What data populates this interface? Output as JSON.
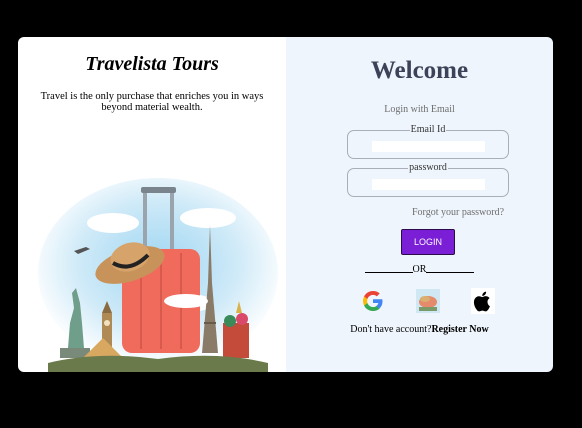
{
  "brand": {
    "title": "Travelista Tours",
    "tagline": "Travel is the only purchase that enriches you in ways beyond material wealth."
  },
  "login": {
    "heading": "Welcome",
    "subheading": "Login with Email",
    "email_label": "Email Id",
    "email_value": "",
    "password_label": "password",
    "password_value": "",
    "forgot_link": "Forgot your password?",
    "login_button": "LOGIN",
    "or_text": "OR",
    "register_prompt": "Don't have account?",
    "register_link": "Register Now"
  },
  "social_icons": [
    "google-icon",
    "photo-icon",
    "apple-icon"
  ],
  "colors": {
    "accent": "#7b1fd6",
    "panel_bg": "#eef5fd",
    "heading": "#3c4257"
  }
}
